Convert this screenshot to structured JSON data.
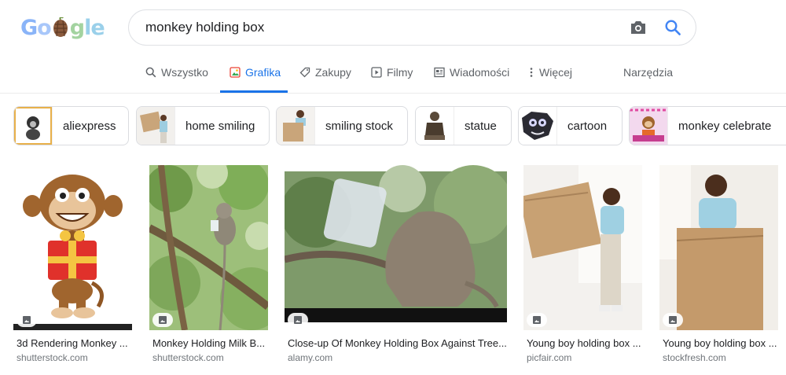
{
  "search": {
    "query": "monkey holding box"
  },
  "tabs": [
    {
      "label": "Wszystko",
      "icon": "search-icon"
    },
    {
      "label": "Grafika",
      "icon": "image-icon"
    },
    {
      "label": "Zakupy",
      "icon": "tag-icon"
    },
    {
      "label": "Filmy",
      "icon": "play-icon"
    },
    {
      "label": "Wiadomości",
      "icon": "news-icon"
    },
    {
      "label": "Więcej",
      "icon": "more-vert-icon"
    }
  ],
  "tools": {
    "label": "Narzędzia"
  },
  "chips": [
    {
      "label": "aliexpress"
    },
    {
      "label": "home smiling"
    },
    {
      "label": "smiling stock"
    },
    {
      "label": "statue"
    },
    {
      "label": "cartoon"
    },
    {
      "label": "monkey celebrate"
    }
  ],
  "results": [
    {
      "title": "3d Rendering Monkey ...",
      "source": "shutterstock.com"
    },
    {
      "title": "Monkey Holding Milk B...",
      "source": "shutterstock.com"
    },
    {
      "title": "Close-up Of Monkey Holding Box Against Tree...",
      "source": "alamy.com"
    },
    {
      "title": "Young boy holding box ...",
      "source": "picfair.com"
    },
    {
      "title": "Young boy holding box ...",
      "source": "stockfresh.com"
    }
  ],
  "colors": {
    "accent": "#1a73e8",
    "border": "#dfe1e5",
    "muted": "#5f6368"
  }
}
